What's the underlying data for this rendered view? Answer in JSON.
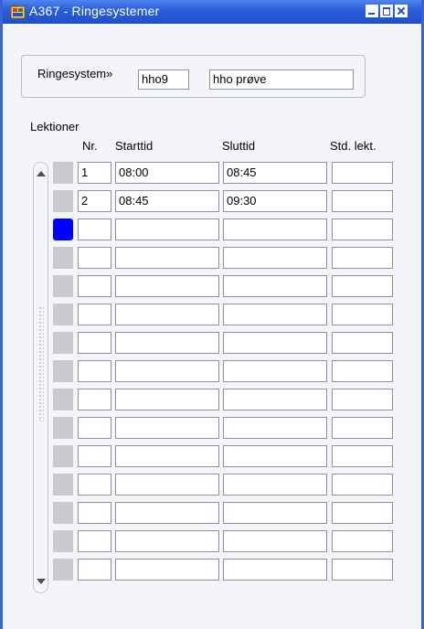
{
  "window": {
    "title": "A367 - Ringesystemer",
    "controls": [
      "minimize",
      "maximize",
      "close"
    ]
  },
  "header": {
    "ringesystem_label": "Ringesystem»",
    "code": "hho9",
    "name": "hho prøve"
  },
  "lektioner": {
    "section_label": "Lektioner",
    "columns": [
      "Nr.",
      "Starttid",
      "Sluttid",
      "Std. lekt."
    ],
    "rows": [
      {
        "nr": "1",
        "start": "08:00",
        "slut": "08:45",
        "std": ""
      },
      {
        "nr": "2",
        "start": "08:45",
        "slut": "09:30",
        "std": ""
      },
      {
        "nr": "",
        "start": "",
        "slut": "",
        "std": ""
      },
      {
        "nr": "",
        "start": "",
        "slut": "",
        "std": ""
      },
      {
        "nr": "",
        "start": "",
        "slut": "",
        "std": ""
      },
      {
        "nr": "",
        "start": "",
        "slut": "",
        "std": ""
      },
      {
        "nr": "",
        "start": "",
        "slut": "",
        "std": ""
      },
      {
        "nr": "",
        "start": "",
        "slut": "",
        "std": ""
      },
      {
        "nr": "",
        "start": "",
        "slut": "",
        "std": ""
      },
      {
        "nr": "",
        "start": "",
        "slut": "",
        "std": ""
      },
      {
        "nr": "",
        "start": "",
        "slut": "",
        "std": ""
      },
      {
        "nr": "",
        "start": "",
        "slut": "",
        "std": ""
      },
      {
        "nr": "",
        "start": "",
        "slut": "",
        "std": ""
      },
      {
        "nr": "",
        "start": "",
        "slut": "",
        "std": ""
      },
      {
        "nr": "",
        "start": "",
        "slut": "",
        "std": ""
      }
    ],
    "current_row": 3
  },
  "colors": {
    "titlebar": "#2b5fdc",
    "current_row_indicator": "#0000ff",
    "row_selector": "#c9cacf"
  }
}
